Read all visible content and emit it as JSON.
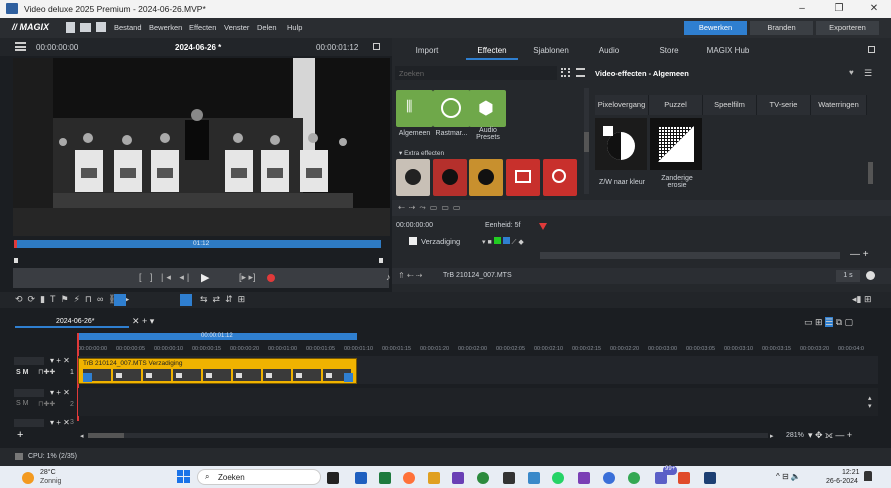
{
  "window": {
    "title": "Video deluxe 2025 Premium - 2024-06-26.MVP*"
  },
  "menu": {
    "brand": "// MAGIX",
    "items": [
      "Bestand",
      "Bewerken",
      "Effecten",
      "Venster",
      "Delen",
      "Hulp"
    ]
  },
  "modes": {
    "edit": "Bewerken",
    "burn": "Branden",
    "export": "Exporteren"
  },
  "preview": {
    "time_left": "00:00:00:00",
    "title": "2024-06-26 *",
    "time_right": "00:00:01:12",
    "bar_label": "01:12"
  },
  "panel_tabs": [
    "Import",
    "Effecten",
    "Sjablonen",
    "Audio",
    "Store",
    "MAGIX Hub"
  ],
  "effects": {
    "search_placeholder": "Zoeken",
    "header": "Video-effecten - Algemeen",
    "categories_row1": [
      "Algemeen",
      "Rastmar...",
      "Audio Presets"
    ],
    "section_extra": "Extra effecten",
    "transitions": [
      "Pixelovergang",
      "Puzzel",
      "Speelfilm",
      "TV-serie",
      "Waterringen"
    ],
    "tiles": [
      "Z/W naar kleur",
      "Zanderige erosie"
    ]
  },
  "keyframes": {
    "time": "00:00:00:00",
    "unit": "Eenheid: 5f",
    "track_label": "Verzadiging",
    "clip_name": "TrB 210124_007.MTS",
    "zoom": "1 s"
  },
  "timeline": {
    "tab": "2024-06-26*",
    "ruler_top": "00:00:01:12",
    "ruler": [
      "00:00:00:00",
      "00:00:00:05",
      "00:00:00:10",
      "00:00:00:15",
      "00:00:00:20",
      "00:00:01:00",
      "00:00:01:05",
      "00:00:01:10",
      "00:00:01:15",
      "00:00:01:20",
      "00:00:02:00",
      "00:00:02:05",
      "00:00:02:10",
      "00:00:02:15",
      "00:00:02:20",
      "00:00:03:00",
      "00:00:03:05",
      "00:00:03:10",
      "00:00:03:15",
      "00:00:03:20",
      "00:00:04:0"
    ],
    "tracks": [
      "1",
      "2",
      "3"
    ],
    "track_prefix": "S M",
    "clip_label": "TrB 210124_007.MTS   Verzadiging",
    "zoom": "281%"
  },
  "status": {
    "cpu": "CPU:  1% (2/35)"
  },
  "taskbar": {
    "weather_temp": "28°C",
    "weather_desc": "Zonnig",
    "search": "Zoeken",
    "time": "12:21",
    "date": "26-6-2024",
    "badge": "99+"
  },
  "colors": {
    "accent": "#2f7fd0",
    "clip": "#f0b300",
    "red": "#e03a3a"
  }
}
